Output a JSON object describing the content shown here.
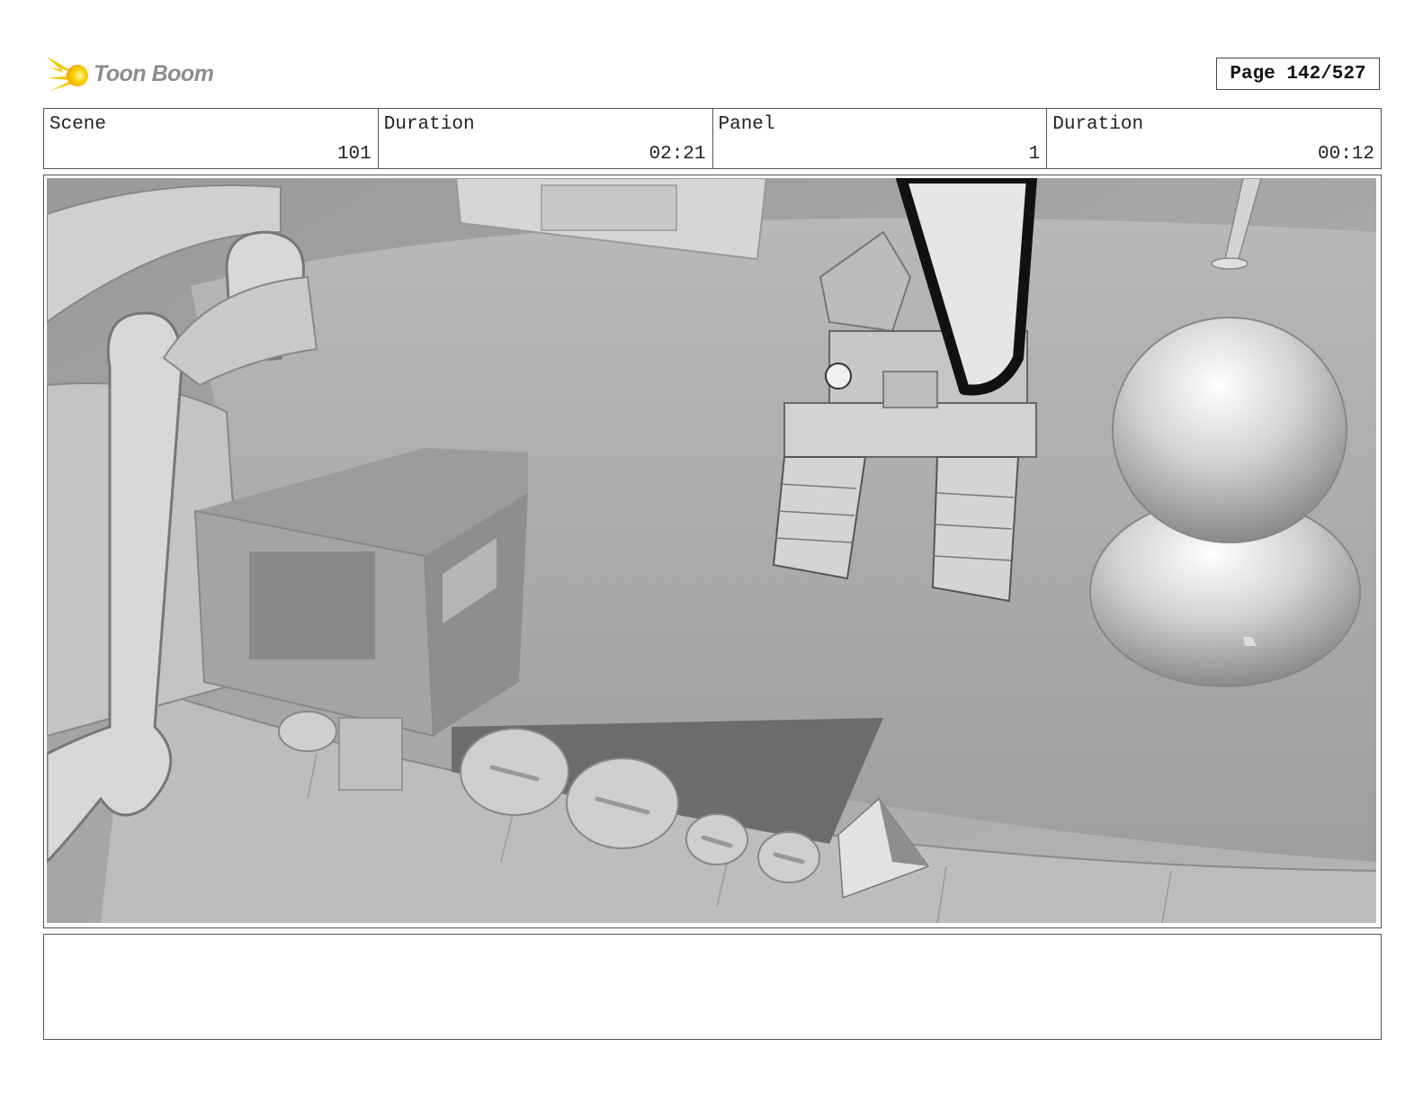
{
  "logo": {
    "text": "Toon Boom",
    "icon": "toon-boom-star-icon",
    "accent_color": "#f5c400"
  },
  "page": {
    "label": "Page 142/527"
  },
  "info": {
    "scene_label": "Scene",
    "scene_value": "101",
    "scene_duration_label": "Duration",
    "scene_duration_value": "02:21",
    "panel_label": "Panel",
    "panel_value": "1",
    "panel_duration_label": "Duration",
    "panel_duration_value": "00:12"
  },
  "panel": {
    "image": "grey-3d-render-toy-train-and-crane"
  },
  "notes": {
    "text": ""
  }
}
